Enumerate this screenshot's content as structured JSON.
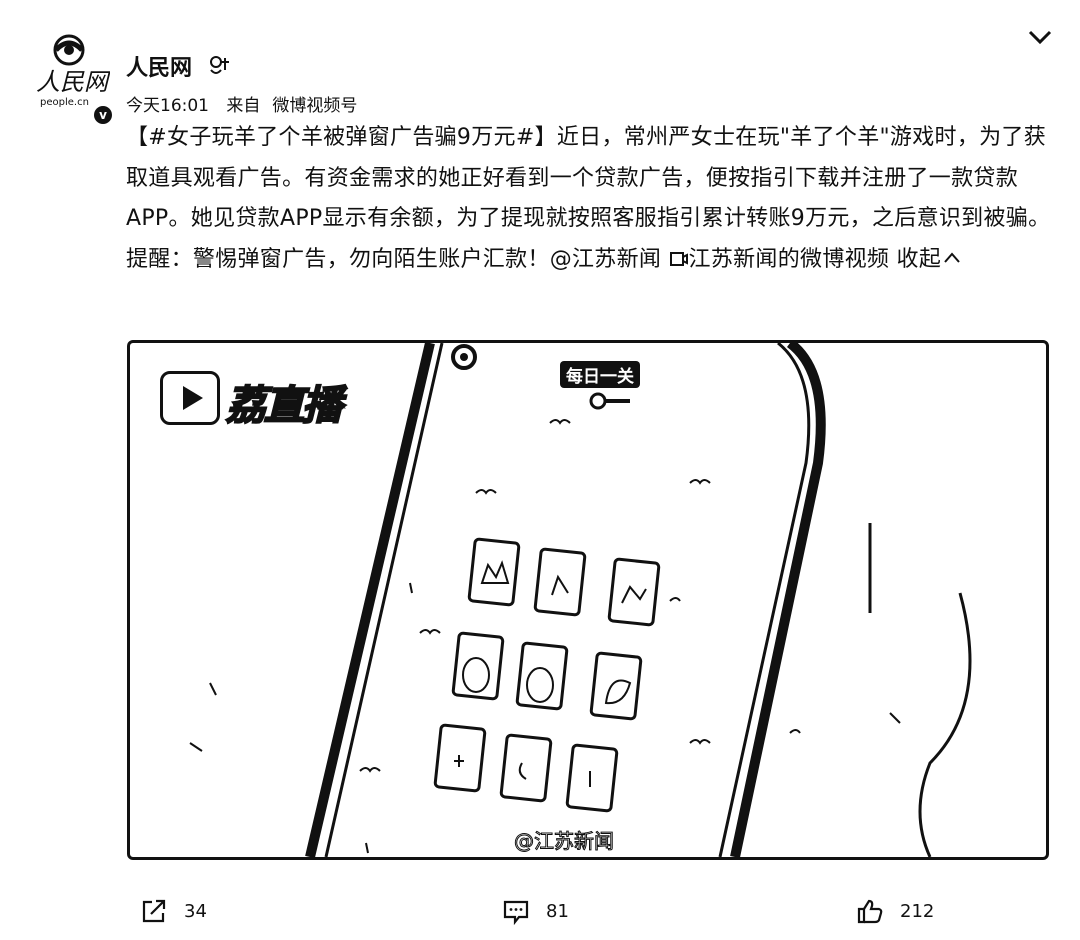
{
  "post": {
    "author": "人民网",
    "avatar_text": "人民网",
    "avatar_subtext": "people.cn",
    "time": "今天16:01",
    "source_prefix": "来自",
    "source": "微博视频号",
    "content": {
      "hashtag": "【#女子玩羊了个羊被弹窗广告骗9万元#】",
      "body": "近日，常州严女士在玩\"羊了个羊\"游戏时，为了获取道具观看广告。有资金需求的她正好看到一个贷款广告，便按指引下载并注册了一款贷款APP。她见贷款APP显示有余额，为了提现就按照客服指引累计转账9万元，之后意识到被骗。提醒：警惕弹窗广告，勿向陌生账户汇款！",
      "mention": "@江苏新闻",
      "video_link": "江苏新闻的微博视频",
      "collapse_label": "收起"
    },
    "video": {
      "channel_logo_text": "荔直播",
      "daily_badge": "每日一关",
      "watermark": "@江苏新闻"
    },
    "actions": {
      "share_count": "34",
      "comment_count": "81",
      "like_count": "212"
    }
  },
  "icons": [
    "verified-icon",
    "chevron-down-icon",
    "video-link-icon",
    "chevron-up-icon",
    "share-icon",
    "comment-icon",
    "like-icon"
  ],
  "colors": {
    "text": "#111111",
    "background": "#ffffff"
  }
}
